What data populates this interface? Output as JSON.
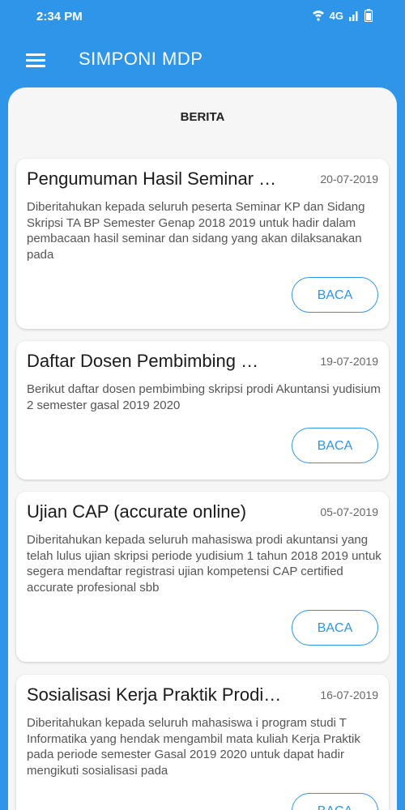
{
  "status_bar": {
    "time": "2:34 PM",
    "network": "4G",
    "icons": [
      "wifi-icon",
      "signal-icon",
      "battery-icon"
    ]
  },
  "app_bar": {
    "title": "SIMPONI MDP",
    "menu_icon": "hamburger-menu-icon"
  },
  "section": {
    "title": "BERITA"
  },
  "colors": {
    "primary": "#2f95e8",
    "background": "#f6f6f6",
    "card": "#ffffff"
  },
  "news": [
    {
      "title": "Pengumuman Hasil Seminar …",
      "date": "20-07-2019",
      "body": "Diberitahukan kepada seluruh peserta Seminar KP dan Sidang Skripsi TA BP Semester Genap 2018 2019 untuk hadir dalam pembacaan hasil seminar dan sidang yang akan dilaksanakan pada",
      "button": "BACA"
    },
    {
      "title": "Daftar Dosen Pembimbing …",
      "date": "19-07-2019",
      "body": "Berikut daftar dosen pembimbing skripsi prodi Akuntansi yudisium 2 semester gasal 2019 2020",
      "button": "BACA"
    },
    {
      "title": "Ujian CAP (accurate online)",
      "date": "05-07-2019",
      "body": "Diberitahukan kepada seluruh mahasiswa prodi akuntansi yang telah lulus ujian skripsi periode yudisium 1 tahun 2018 2019 untuk segera mendaftar registrasi ujian kompetensi CAP certified accurate profesional sbb",
      "button": "BACA"
    },
    {
      "title": "Sosialisasi Kerja Praktik Prodi…",
      "date": "16-07-2019",
      "body": "Diberitahukan kepada seluruh mahasiswa i program studi T Informatika yang hendak mengambil mata kuliah Kerja Praktik pada periode semester Gasal 2019 2020 untuk dapat hadir mengikuti sosialisasi pada",
      "button": "BACA"
    }
  ]
}
